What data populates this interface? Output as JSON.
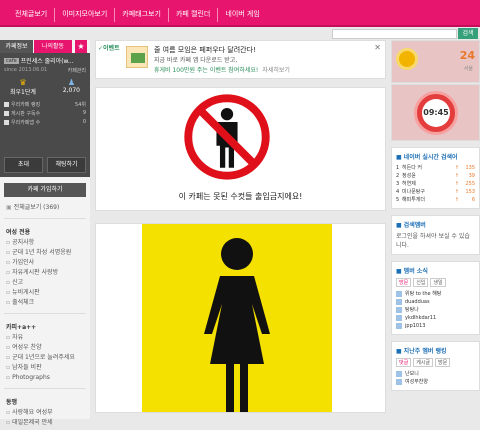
{
  "topnav": [
    "전체글보기",
    "이미지모아보기",
    "카페태그보기",
    "카페 캘린더",
    "네이버 게임"
  ],
  "search": {
    "button": "검색"
  },
  "left": {
    "tab_info": "카페정보",
    "tab_activity": "나의활동",
    "cafe_badge": "cafe",
    "cafe_name": "프린세스 줄리아(w...",
    "since": "since 2013.06.01",
    "manage": "카페관리",
    "level": "최우1단계",
    "members": "2,070",
    "stats": [
      {
        "label": "우리카페 랭킹",
        "value": "54위"
      },
      {
        "label": "게시판 구독수",
        "value": "9"
      },
      {
        "label": "우리카페앱 수",
        "value": "0"
      }
    ],
    "invite": "초대",
    "chat": "채팅하기",
    "join": "카페 가입하기",
    "all_posts": "전체글보기 (369)",
    "sections": [
      {
        "title": "여성 전용",
        "items": [
          "공지사항",
          "군대 1년 차성 서명응원",
          "가입인사",
          "자유게시판 사랑방",
          "신고",
          "뉴비게시판",
          "출석체크"
        ]
      },
      {
        "title": "카피+a++",
        "items": [
          "자유",
          "여성우 찬양",
          "군대 1년으로 늘려주세요",
          "남자들 비판",
          "Photographs"
        ]
      },
      {
        "title": "동맹",
        "items": [
          "사랑해요 여성부",
          "대일본제국 만세"
        ]
      }
    ]
  },
  "ad": {
    "label": "✓이벤트",
    "line1": "줄 여름 모임은 페퍼우다 달려간다!",
    "line2": "지금 바로 카페 앱 다운로드 받고,",
    "line3": "휴게비 100만원 주는 이벤트 참여하세요!",
    "link": "자세히보기"
  },
  "post": {
    "caption": "이 카페는 못된 수컷들 출입금지에요!"
  },
  "right": {
    "temp": "24",
    "temp_unit": "서울",
    "clock": "09:45",
    "realtime_title": "네이버 실시간 검색어",
    "ranks": [
      {
        "n": "1",
        "word": "히든다 커",
        "count": "135"
      },
      {
        "n": "2",
        "word": "정성윤",
        "count": "39"
      },
      {
        "n": "3",
        "word": "허연제",
        "count": "255"
      },
      {
        "n": "4",
        "word": "미나문탕구",
        "count": "153"
      },
      {
        "n": "5",
        "word": "해피투게더",
        "count": "6"
      }
    ],
    "login_title": "검색멤버",
    "login_text": "로그인을 하셔야 보실 수 있습니다.",
    "members_title": "멤버 소식",
    "member_tabs": [
      "방문",
      "신입",
      "생일"
    ],
    "members": [
      "위탕 to the 해탕",
      "duadduas",
      "탕탕나",
      "ykdlhkdar11",
      "jpp1013"
    ],
    "rank_title": "지난주 멤버 랭킹",
    "rank_tabs": [
      "댓글",
      "게시글",
      "방문"
    ],
    "rank_items": [
      "난보니",
      "여성부찬양"
    ]
  }
}
